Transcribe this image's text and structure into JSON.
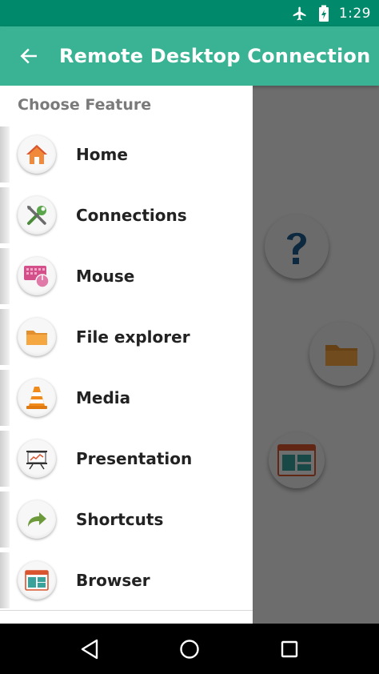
{
  "status_bar": {
    "time": "1:29",
    "icons": [
      "airplane-icon",
      "battery-charging-icon"
    ]
  },
  "app_bar": {
    "title": "Remote Desktop Connection",
    "back_icon": "arrow-left-icon",
    "color": "#3ab294",
    "status_color": "#00896a"
  },
  "drawer": {
    "header": "Choose Feature",
    "items": [
      {
        "label": "Home",
        "icon": "home-icon"
      },
      {
        "label": "Connections",
        "icon": "tools-icon"
      },
      {
        "label": "Mouse",
        "icon": "mouse-keyboard-icon"
      },
      {
        "label": "File explorer",
        "icon": "folder-icon"
      },
      {
        "label": "Media",
        "icon": "traffic-cone-icon"
      },
      {
        "label": "Presentation",
        "icon": "presentation-board-icon"
      },
      {
        "label": "Shortcuts",
        "icon": "share-arrow-icon"
      },
      {
        "label": "Browser",
        "icon": "browser-window-icon"
      }
    ]
  },
  "background": {
    "buttons": [
      "help-icon",
      "folder-icon",
      "browser-window-icon"
    ]
  },
  "nav_bar": {
    "buttons": [
      "back-triangle-icon",
      "home-circle-icon",
      "recents-square-icon"
    ]
  }
}
